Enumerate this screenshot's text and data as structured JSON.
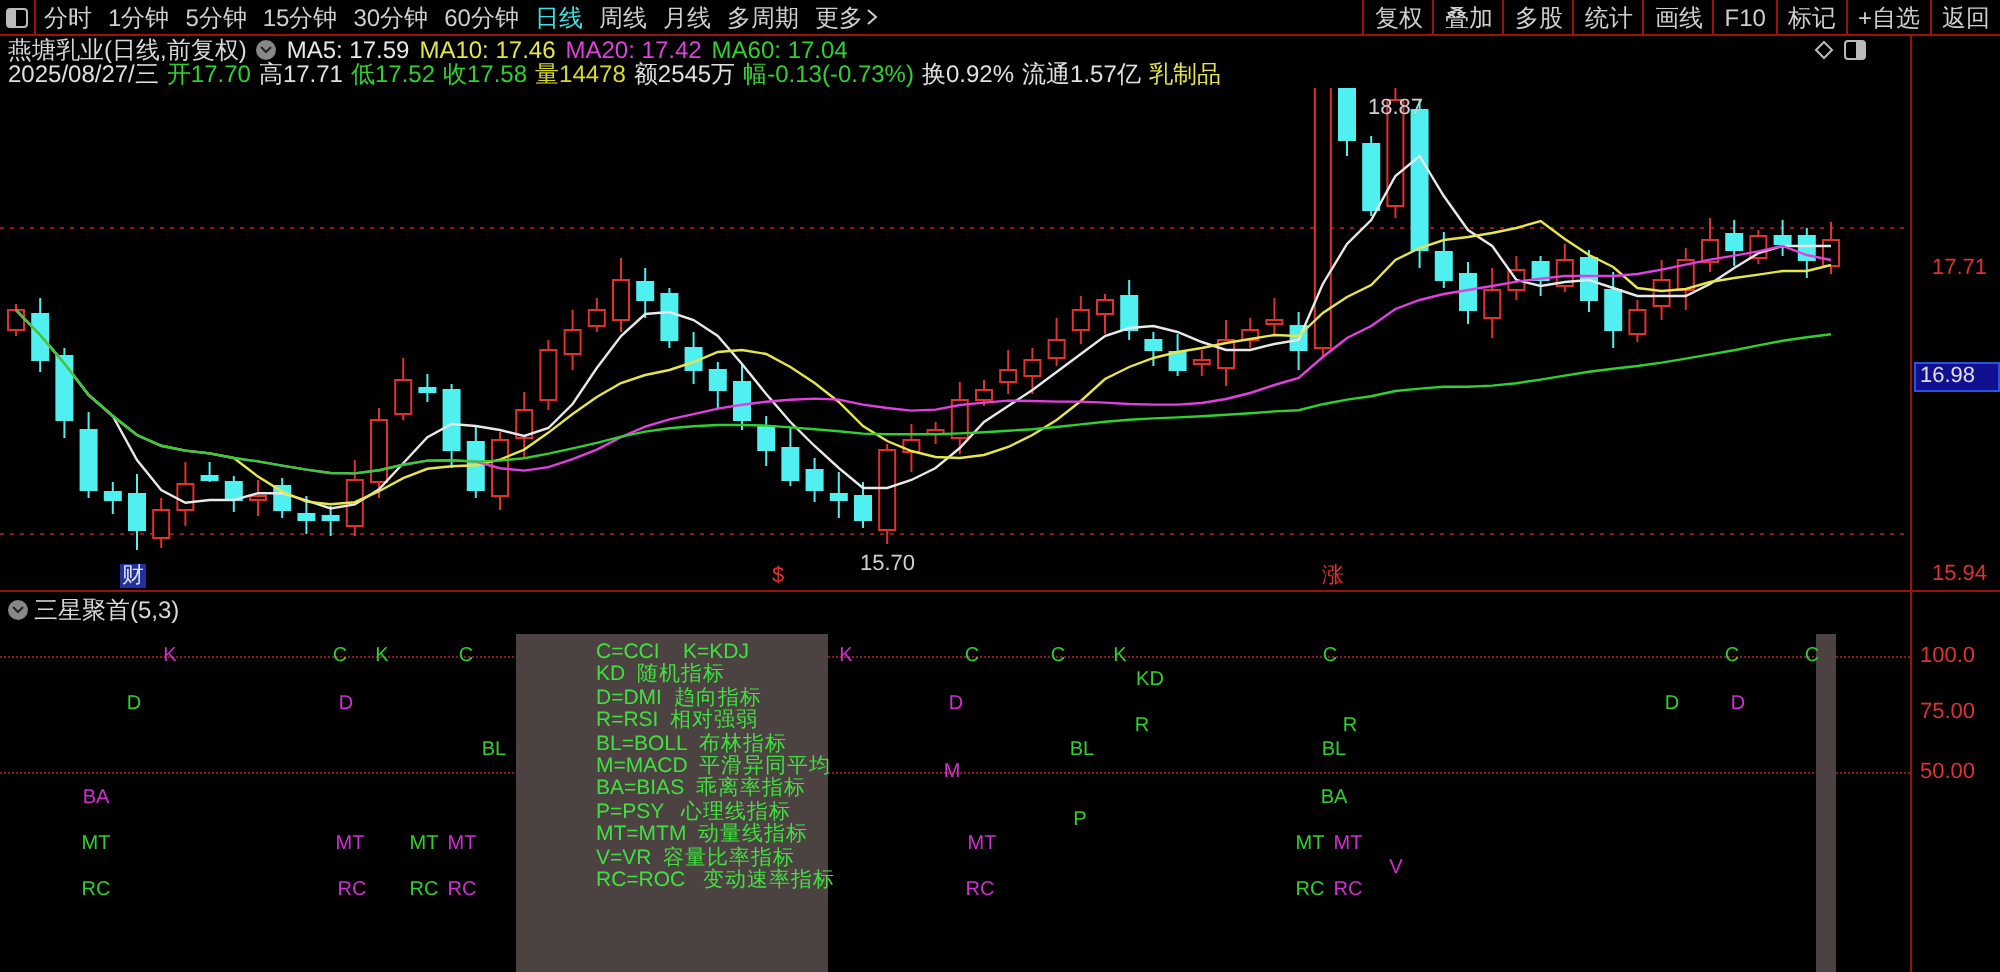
{
  "toolbar": {
    "periods": [
      {
        "label": "分时",
        "selected": false
      },
      {
        "label": "1分钟",
        "selected": false
      },
      {
        "label": "5分钟",
        "selected": false
      },
      {
        "label": "15分钟",
        "selected": false
      },
      {
        "label": "30分钟",
        "selected": false
      },
      {
        "label": "60分钟",
        "selected": false
      },
      {
        "label": "日线",
        "selected": true
      },
      {
        "label": "周线",
        "selected": false
      },
      {
        "label": "月线",
        "selected": false
      },
      {
        "label": "多周期",
        "selected": false
      },
      {
        "label": "更多",
        "selected": false
      }
    ],
    "buttons": [
      "复权",
      "叠加",
      "多股",
      "统计",
      "画线",
      "F10",
      "标记",
      "+自选",
      "返回"
    ]
  },
  "stock_header": {
    "title": "燕塘乳业(日线,前复权)",
    "moving_averages": [
      {
        "label": "MA5: 17.59",
        "color": "#e8e8e8"
      },
      {
        "label": "MA10: 17.46",
        "color": "#e6e64c"
      },
      {
        "label": "MA20: 17.42",
        "color": "#e040e0"
      },
      {
        "label": "MA60: 17.04",
        "color": "#30d030"
      }
    ]
  },
  "quote_line": [
    {
      "text": "2025/08/27/三",
      "color": "#e0e0e0"
    },
    {
      "text": "开17.70",
      "color": "#30d030"
    },
    {
      "text": "高17.71",
      "color": "#e0e0e0"
    },
    {
      "text": "低17.52",
      "color": "#30d030"
    },
    {
      "text": "收17.58",
      "color": "#30d030"
    },
    {
      "text": "量14478",
      "color": "#d8d830"
    },
    {
      "text": "额2545万",
      "color": "#e0e0e0"
    },
    {
      "text": "幅-0.13(-0.73%)",
      "color": "#30d030"
    },
    {
      "text": "换0.92%",
      "color": "#e0e0e0"
    },
    {
      "text": "流通1.57亿",
      "color": "#e0e0e0"
    },
    {
      "text": "乳制品",
      "color": "#e6e64c"
    }
  ],
  "price_chart": {
    "axis_labels": [
      {
        "text": "17.71",
        "kind": "tick"
      },
      {
        "text": "16.98",
        "kind": "current"
      },
      {
        "text": "15.94",
        "kind": "tick"
      }
    ],
    "high_label": "18.87",
    "low_label": "15.70",
    "event_markers": [
      {
        "text": "财",
        "kind": "badge"
      },
      {
        "text": "$",
        "kind": "plain"
      },
      {
        "text": "涨",
        "kind": "plain"
      }
    ]
  },
  "indicator": {
    "title": "三星聚首(5,3)",
    "axis_labels": [
      "100.0",
      "75.00",
      "50.00"
    ],
    "legend": [
      "C=CCI    K=KDJ",
      "KD  随机指标",
      "D=DMI  趋向指标",
      "R=RSI  相对强弱",
      "BL=BOLL  布林指标",
      "M=MACD  平滑异同平均",
      "BA=BIAS  乖离率指标",
      "P=PSY   心理线指标",
      "MT=MTM  动量线指标",
      "V=VR  容量比率指标",
      "RC=ROC   变动速率指标"
    ],
    "signals": [
      {
        "text": "K",
        "color": "#d030d0"
      },
      {
        "text": "C",
        "color": "#30d030"
      },
      {
        "text": "K",
        "color": "#30d030"
      },
      {
        "text": "C",
        "color": "#30d030"
      },
      {
        "text": "K",
        "color": "#d030d0"
      },
      {
        "text": "C",
        "color": "#30d030"
      },
      {
        "text": "C",
        "color": "#30d030"
      },
      {
        "text": "K",
        "color": "#30d030"
      },
      {
        "text": "C",
        "color": "#30d030"
      },
      {
        "text": "C",
        "color": "#30d030"
      },
      {
        "text": "C",
        "color": "#30d030"
      },
      {
        "text": "KD",
        "color": "#30d030"
      },
      {
        "text": "D",
        "color": "#30d030"
      },
      {
        "text": "D",
        "color": "#d030d0"
      },
      {
        "text": "D",
        "color": "#d030d0"
      },
      {
        "text": "D",
        "color": "#30d030"
      },
      {
        "text": "D",
        "color": "#d030d0"
      },
      {
        "text": "R",
        "color": "#30d030"
      },
      {
        "text": "R",
        "color": "#30d030"
      },
      {
        "text": "BL",
        "color": "#30d030"
      },
      {
        "text": "BL",
        "color": "#30d030"
      },
      {
        "text": "BL",
        "color": "#30d030"
      },
      {
        "text": "M",
        "color": "#d030d0"
      },
      {
        "text": "BA",
        "color": "#d030d0"
      },
      {
        "text": "BA",
        "color": "#30d030"
      },
      {
        "text": "P",
        "color": "#30d030"
      },
      {
        "text": "MT",
        "color": "#30d030"
      },
      {
        "text": "MT",
        "color": "#d030d0"
      },
      {
        "text": "MT",
        "color": "#30d030"
      },
      {
        "text": "MT",
        "color": "#d030d0"
      },
      {
        "text": "MT",
        "color": "#d030d0"
      },
      {
        "text": "MT",
        "color": "#30d030"
      },
      {
        "text": "MT",
        "color": "#d030d0"
      },
      {
        "text": "V",
        "color": "#d030d0"
      },
      {
        "text": "RC",
        "color": "#30d030"
      },
      {
        "text": "RC",
        "color": "#d030d0"
      },
      {
        "text": "RC",
        "color": "#30d030"
      },
      {
        "text": "RC",
        "color": "#d030d0"
      },
      {
        "text": "RC",
        "color": "#d030d0"
      },
      {
        "text": "RC",
        "color": "#30d030"
      },
      {
        "text": "RC",
        "color": "#d030d0"
      }
    ]
  }
}
